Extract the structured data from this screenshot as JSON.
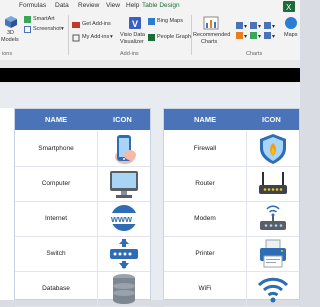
{
  "ribbon": {
    "tabs": [
      {
        "label": "Formulas",
        "active": false
      },
      {
        "label": "Data",
        "active": false
      },
      {
        "label": "Review",
        "active": false
      },
      {
        "label": "View",
        "active": false
      },
      {
        "label": "Help",
        "active": false
      },
      {
        "label": "Table Design",
        "active": true
      }
    ],
    "buttons": {
      "threed_models_line1": "3D",
      "threed_models_line2": "Models",
      "smartart": "SmartArt",
      "screenshot": "Screenshot",
      "get_addins": "Get Add-ins",
      "my_addins": "My Add-ins",
      "visio_line1": "Visio Data",
      "visio_line2": "Visualizer",
      "bing_maps": "Bing Maps",
      "people_graph": "People Graph",
      "recommended_line1": "Recommended",
      "recommended_line2": "Charts",
      "maps": "Maps"
    },
    "group_labels": {
      "illustrations": "ions",
      "addins": "Add-ins",
      "charts": "Charts"
    }
  },
  "tables": {
    "header_name": "NAME",
    "header_icon": "ICON",
    "left": [
      {
        "name": "Smartphone",
        "icon": "smartphone-icon"
      },
      {
        "name": "Computer",
        "icon": "computer-icon"
      },
      {
        "name": "Internet",
        "icon": "internet-icon"
      },
      {
        "name": "Switch",
        "icon": "switch-icon"
      },
      {
        "name": "Database",
        "icon": "database-icon"
      }
    ],
    "right": [
      {
        "name": "Firewall",
        "icon": "firewall-icon"
      },
      {
        "name": "Router",
        "icon": "router-icon"
      },
      {
        "name": "Modem",
        "icon": "modem-icon"
      },
      {
        "name": "Printer",
        "icon": "printer-icon"
      },
      {
        "name": "WiFi",
        "icon": "wifi-icon"
      }
    ]
  },
  "colors": {
    "header_blue": "#4a73b8",
    "accent_green": "#1e6b3a"
  }
}
